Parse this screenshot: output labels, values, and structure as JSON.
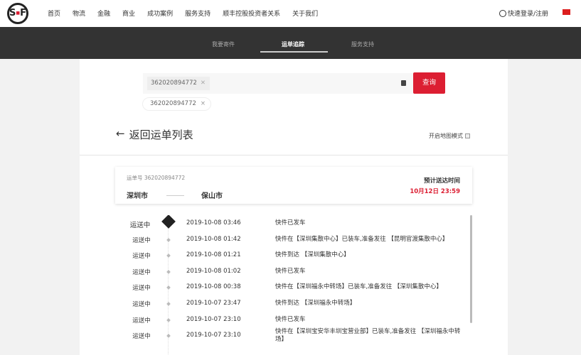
{
  "header": {
    "logo": "SF",
    "menu": [
      "首页",
      "物流",
      "金融",
      "商业",
      "成功案例",
      "服务支持",
      "顺丰控股投资者关系",
      "关于我们"
    ],
    "login": "快速登录/注册"
  },
  "nav": {
    "tabs": [
      "我要寄件",
      "运单追踪",
      "服务支持"
    ],
    "active": "运单追踪"
  },
  "search": {
    "chip": "362020894772",
    "history": "362020894772",
    "button": "查询"
  },
  "back": "返回运单列表",
  "map_mode": "开启地图模式",
  "card": {
    "waybill_label": "运单号 362020894772",
    "from": "深圳市",
    "to": "保山市",
    "eta_label": "预计送达时间",
    "eta": "10月12日 23:59"
  },
  "timeline": [
    {
      "status": "运送中",
      "time": "2019-10-08 03:46",
      "desc": "快件已发车"
    },
    {
      "status": "运送中",
      "time": "2019-10-08 01:42",
      "desc": "快件在【深圳集散中心】已装车,准备发往 【昆明官渡集散中心】"
    },
    {
      "status": "运送中",
      "time": "2019-10-08 01:21",
      "desc": "快件到达 【深圳集散中心】"
    },
    {
      "status": "运送中",
      "time": "2019-10-08 01:02",
      "desc": "快件已发车"
    },
    {
      "status": "运送中",
      "time": "2019-10-08 00:38",
      "desc": "快件在【深圳福永中转场】已装车,准备发往 【深圳集散中心】"
    },
    {
      "status": "运送中",
      "time": "2019-10-07 23:47",
      "desc": "快件到达 【深圳福永中转场】"
    },
    {
      "status": "运送中",
      "time": "2019-10-07 23:10",
      "desc": "快件已发车"
    },
    {
      "status": "运送中",
      "time": "2019-10-07 23:10",
      "desc": "快件在【深圳宝安华丰圳宝营业部】已装车,准备发往 【深圳福永中转场】"
    }
  ]
}
